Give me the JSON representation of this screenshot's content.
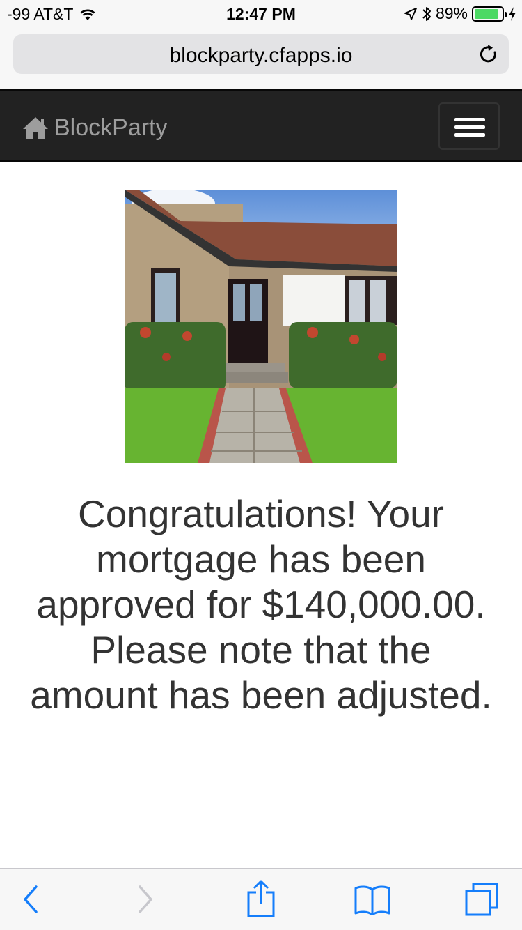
{
  "status_bar": {
    "carrier": "-99 AT&T",
    "time": "12:47 PM",
    "battery_percent": "89%",
    "battery_level": 0.89
  },
  "browser": {
    "url": "blockparty.cfapps.io"
  },
  "navbar": {
    "brand": "BlockParty"
  },
  "main": {
    "message": "Congratulations! Your mortgage has been approved for $140,000.00. Please note that the amount has been adjusted."
  },
  "colors": {
    "navbar_bg": "#222222",
    "brand_text": "#9d9d9d",
    "ios_blue": "#157efb",
    "battery_green": "#4cd964"
  }
}
